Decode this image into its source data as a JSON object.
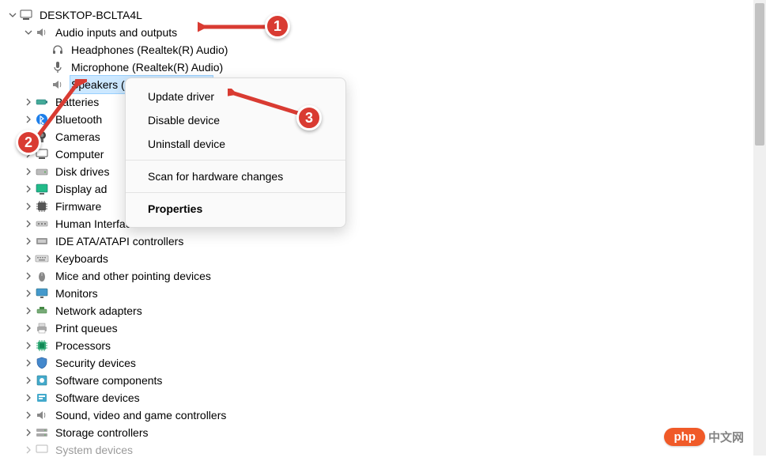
{
  "root": {
    "label": "DESKTOP-BCLTA4L"
  },
  "audio": {
    "label": "Audio inputs and outputs",
    "children": {
      "headphones": "Headphones (Realtek(R) Audio)",
      "microphone": "Microphone (Realtek(R) Audio)",
      "speakers": "Speakers (Realtek(R) Audio)"
    }
  },
  "categories": [
    "Batteries",
    "Bluetooth",
    "Cameras",
    "Computer",
    "Disk drives",
    "Display ad",
    "Firmware",
    "Human Interface Devices",
    "IDE ATA/ATAPI controllers",
    "Keyboards",
    "Mice and other pointing devices",
    "Monitors",
    "Network adapters",
    "Print queues",
    "Processors",
    "Security devices",
    "Software components",
    "Software devices",
    "Sound, video and game controllers",
    "Storage controllers",
    "System devices"
  ],
  "menu": {
    "update": "Update driver",
    "disable": "Disable device",
    "uninstall": "Uninstall device",
    "scan": "Scan for hardware changes",
    "properties": "Properties"
  },
  "callouts": {
    "c1": "1",
    "c2": "2",
    "c3": "3"
  },
  "watermark": {
    "badge": "php",
    "text": "中文网"
  },
  "colors": {
    "callout": "#d93b32",
    "selection": "#cce8ff",
    "brand": "#f05a28"
  }
}
